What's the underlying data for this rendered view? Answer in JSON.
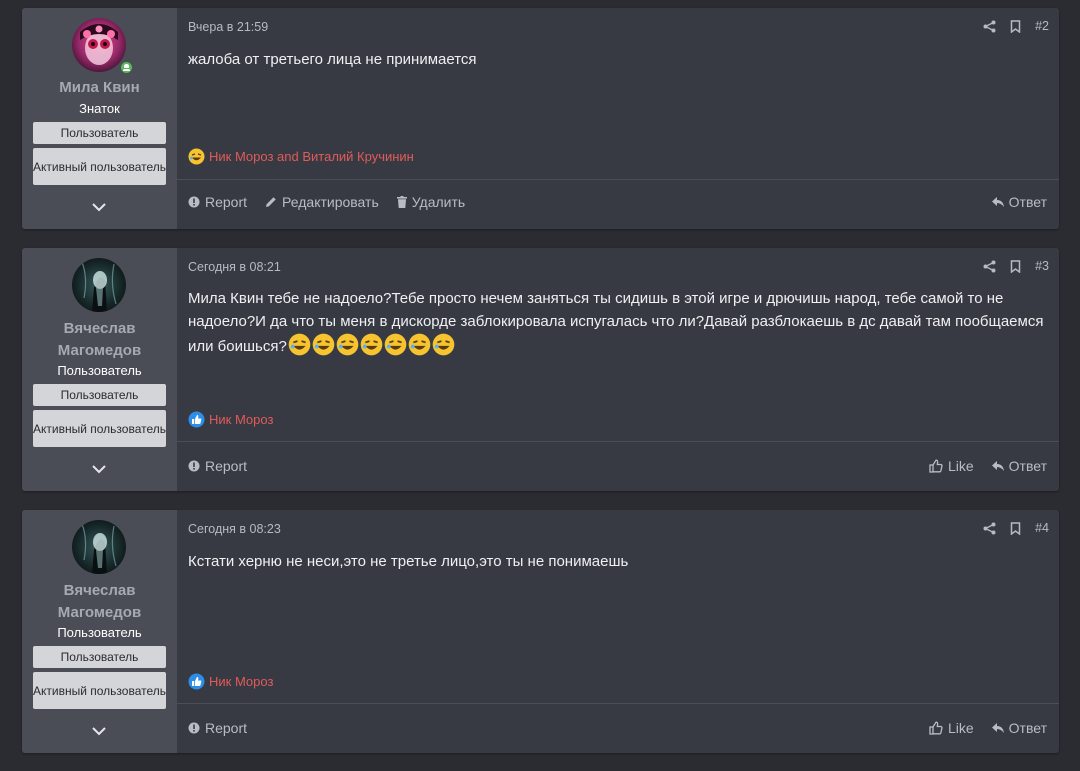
{
  "posts": [
    {
      "author": "Мила Квин",
      "user_title": "Знаток",
      "badges": [
        "Пользователь",
        "Активный пользователь"
      ],
      "date": "Вчера в 21:59",
      "number": "#2",
      "text": "жалоба от третьего лица не принимается",
      "reactions": "Ник Мороз and Виталий Кручинин",
      "reaction_icon": "laughing-emoji-icon",
      "actions": {
        "report": "Report",
        "edit": "Редактировать",
        "delete": "Удалить",
        "reply": "Ответ"
      }
    },
    {
      "author": "Вячеслав Магомедов",
      "user_title": "Пользователь",
      "badges": [
        "Пользователь",
        "Активный пользователь"
      ],
      "date": "Сегодня в 08:21",
      "number": "#3",
      "text": "Мила Квин тебе не надоело?Тебе просто нечем заняться ты сидишь в этой игре и дрючишь народ, тебе самой то не надоело?И да что ты меня в дискорде заблокировала испугалась что ли?Давай разблокаешь в дс давай там пообщаемся или боишься?",
      "emoji_count": 7,
      "reactions": "Ник Мороз",
      "reaction_icon": "thumbs-up-icon",
      "actions": {
        "report": "Report",
        "like": "Like",
        "reply": "Ответ"
      }
    },
    {
      "author": "Вячеслав Магомедов",
      "user_title": "Пользователь",
      "badges": [
        "Пользователь",
        "Активный пользователь"
      ],
      "date": "Сегодня в 08:23",
      "number": "#4",
      "text": "Кстати херню не неси,это не третье лицо,это ты не понимаешь",
      "reactions": "Ник Мороз",
      "reaction_icon": "thumbs-up-icon",
      "actions": {
        "report": "Report",
        "like": "Like",
        "reply": "Ответ"
      }
    }
  ],
  "colors": {
    "page_bg": "#2a2c32",
    "post_bg": "#373a43",
    "user_col_bg": "#4a4d56",
    "reaction_text": "#e05b59",
    "badge_bg": "#d4d5d8",
    "online": "#5cb85c"
  }
}
